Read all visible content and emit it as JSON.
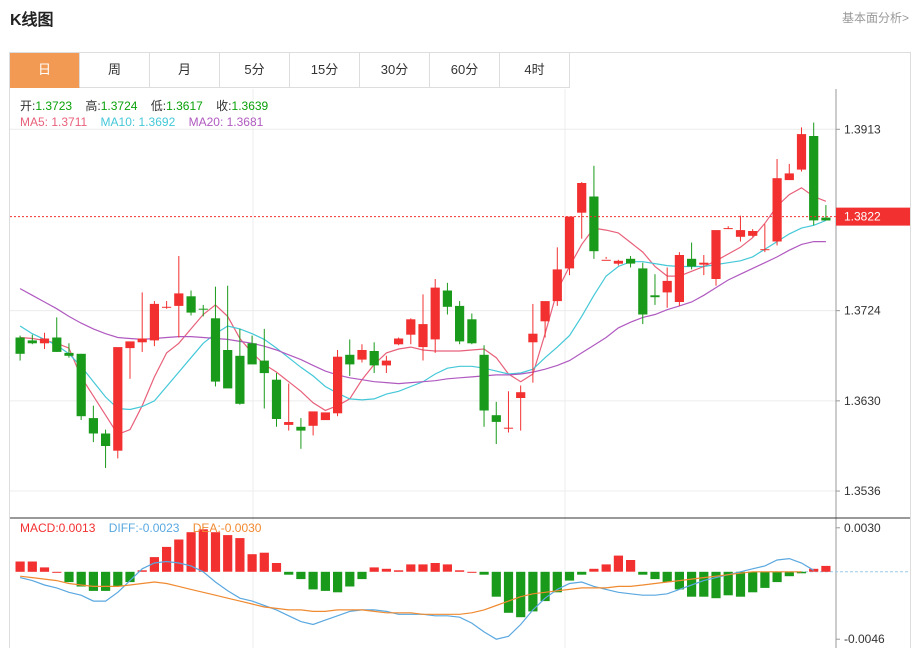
{
  "header": {
    "title": "K线图",
    "fundamental_link": "基本面分析>"
  },
  "tabs": [
    {
      "label": "日",
      "active": true
    },
    {
      "label": "周",
      "active": false
    },
    {
      "label": "月",
      "active": false
    },
    {
      "label": "5分",
      "active": false
    },
    {
      "label": "15分",
      "active": false
    },
    {
      "label": "30分",
      "active": false
    },
    {
      "label": "60分",
      "active": false
    },
    {
      "label": "4时",
      "active": false
    }
  ],
  "ohlc": {
    "open_label": "开:",
    "open": "1.3723",
    "high_label": "高:",
    "high": "1.3724",
    "low_label": "低:",
    "low": "1.3617",
    "close_label": "收:",
    "close": "1.3639"
  },
  "ma": {
    "ma5_label": "MA5:",
    "ma5": "1.3711",
    "ma10_label": "MA10:",
    "ma10": "1.3692",
    "ma20_label": "MA20:",
    "ma20": "1.3681"
  },
  "macd": {
    "macd_label": "MACD:",
    "macd": "0.0013",
    "diff_label": "DIFF:",
    "diff": "-0.0023",
    "dea_label": "DEA:",
    "dea": "-0.0030"
  },
  "colors": {
    "up": "#f23030",
    "down": "#1a9a1a",
    "ma5": "#e8607a",
    "ma10": "#44c8d8",
    "ma20": "#b05ac0",
    "diff": "#5aa8e0",
    "dea": "#f08a30",
    "tab_active": "#f29a53",
    "current_price": "#f23030"
  },
  "chart_data": {
    "type": "candlestick",
    "current_price": "1.3822",
    "y_ticks": [
      "1.3913",
      "1.3724",
      "1.3630",
      "1.3536"
    ],
    "ylim": [
      1.351,
      1.3955
    ],
    "grid": true,
    "candles": [
      [
        1.3696,
        1.3698,
        1.3672,
        1.3679
      ],
      [
        1.3693,
        1.3699,
        1.3689,
        1.369
      ],
      [
        1.369,
        1.3701,
        1.3684,
        1.3695
      ],
      [
        1.3696,
        1.3717,
        1.3681,
        1.3681
      ],
      [
        1.368,
        1.369,
        1.3675,
        1.3677
      ],
      [
        1.3679,
        1.3679,
        1.361,
        1.3614
      ],
      [
        1.3612,
        1.3625,
        1.3587,
        1.3596
      ],
      [
        1.3596,
        1.36,
        1.356,
        1.3583
      ],
      [
        1.3578,
        1.3683,
        1.357,
        1.3686
      ],
      [
        1.3685,
        1.369,
        1.3653,
        1.3692
      ],
      [
        1.3691,
        1.3743,
        1.3681,
        1.3695
      ],
      [
        1.3693,
        1.3734,
        1.3687,
        1.3731
      ],
      [
        1.3728,
        1.3734,
        1.3726,
        1.3728
      ],
      [
        1.3729,
        1.3781,
        1.3696,
        1.3742
      ],
      [
        1.3739,
        1.3745,
        1.3719,
        1.3722
      ],
      [
        1.3726,
        1.373,
        1.3718,
        1.3725
      ],
      [
        1.3716,
        1.3749,
        1.3645,
        1.365
      ],
      [
        1.3683,
        1.375,
        1.3646,
        1.3643
      ],
      [
        1.3677,
        1.3705,
        1.3626,
        1.3627
      ],
      [
        1.369,
        1.3698,
        1.3669,
        1.3668
      ],
      [
        1.3672,
        1.3705,
        1.3622,
        1.3659
      ],
      [
        1.3652,
        1.3659,
        1.3603,
        1.3611
      ],
      [
        1.3605,
        1.3648,
        1.3599,
        1.3608
      ],
      [
        1.3603,
        1.3612,
        1.358,
        1.3599
      ],
      [
        1.3604,
        1.3618,
        1.3594,
        1.3619
      ],
      [
        1.361,
        1.3616,
        1.3611,
        1.3618
      ],
      [
        1.3617,
        1.3683,
        1.3614,
        1.3676
      ],
      [
        1.3678,
        1.3694,
        1.3656,
        1.3668
      ],
      [
        1.3673,
        1.3689,
        1.367,
        1.3683
      ],
      [
        1.3682,
        1.3691,
        1.3659,
        1.3667
      ],
      [
        1.3667,
        1.3677,
        1.3659,
        1.3672
      ],
      [
        1.3689,
        1.3696,
        1.3688,
        1.3695
      ],
      [
        1.3699,
        1.3716,
        1.3689,
        1.3715
      ],
      [
        1.3686,
        1.3741,
        1.3672,
        1.371
      ],
      [
        1.3694,
        1.3757,
        1.368,
        1.3748
      ],
      [
        1.3745,
        1.3753,
        1.372,
        1.3728
      ],
      [
        1.3729,
        1.3734,
        1.3689,
        1.3692
      ],
      [
        1.3715,
        1.3721,
        1.3689,
        1.369
      ],
      [
        1.3678,
        1.3688,
        1.3603,
        1.362
      ],
      [
        1.3615,
        1.3629,
        1.3585,
        1.3608
      ],
      [
        1.3602,
        1.364,
        1.3597,
        1.3602
      ],
      [
        1.3633,
        1.3646,
        1.3599,
        1.3639
      ],
      [
        1.3691,
        1.3731,
        1.3649,
        1.37
      ],
      [
        1.3713,
        1.3715,
        1.3696,
        1.3734
      ],
      [
        1.3734,
        1.379,
        1.3729,
        1.3767
      ],
      [
        1.3768,
        1.3822,
        1.3761,
        1.3822
      ],
      [
        1.3826,
        1.3858,
        1.3799,
        1.3857
      ],
      [
        1.3843,
        1.3875,
        1.3778,
        1.3786
      ],
      [
        1.3776,
        1.3778,
        1.378,
        1.3777
      ],
      [
        1.3773,
        1.3777,
        1.3771,
        1.3776
      ],
      [
        1.3778,
        1.3781,
        1.3769,
        1.3773
      ],
      [
        1.3768,
        1.3774,
        1.371,
        1.372
      ],
      [
        1.374,
        1.3762,
        1.373,
        1.3738
      ],
      [
        1.3743,
        1.3769,
        1.3727,
        1.3755
      ],
      [
        1.3733,
        1.3785,
        1.3729,
        1.3782
      ],
      [
        1.3778,
        1.3795,
        1.3767,
        1.377
      ],
      [
        1.3772,
        1.3782,
        1.3761,
        1.3774
      ],
      [
        1.3757,
        1.3801,
        1.375,
        1.3808
      ],
      [
        1.381,
        1.3812,
        1.3809,
        1.381
      ],
      [
        1.3801,
        1.3823,
        1.3796,
        1.3808
      ],
      [
        1.3802,
        1.3809,
        1.3801,
        1.3807
      ],
      [
        1.3787,
        1.3814,
        1.3785,
        1.3788
      ],
      [
        1.3796,
        1.3882,
        1.3792,
        1.3862
      ],
      [
        1.386,
        1.3877,
        1.3863,
        1.3867
      ],
      [
        1.3871,
        1.3915,
        1.3869,
        1.3908
      ],
      [
        1.3906,
        1.392,
        1.3813,
        1.3818
      ],
      [
        1.3821,
        1.3834,
        1.3819,
        1.3818
      ]
    ],
    "ma5": [
      1.3696,
      1.3695,
      1.3693,
      1.369,
      1.3685,
      1.3655,
      1.3635,
      1.3615,
      1.3595,
      1.36,
      1.3625,
      1.3655,
      1.368,
      1.369,
      1.3705,
      1.372,
      1.373,
      1.3718,
      1.3695,
      1.368,
      1.3668,
      1.366,
      1.365,
      1.364,
      1.3628,
      1.362,
      1.3625,
      1.3632,
      1.3652,
      1.3668,
      1.368,
      1.3684,
      1.3686,
      1.3683,
      1.3682,
      1.3682,
      1.3682,
      1.3683,
      1.3684,
      1.3675,
      1.3658,
      1.365,
      1.3658,
      1.37,
      1.3745,
      1.377,
      1.3793,
      1.381,
      1.3808,
      1.3805,
      1.3795,
      1.3785,
      1.377,
      1.376,
      1.376,
      1.3765,
      1.377,
      1.3776,
      1.3783,
      1.379,
      1.38,
      1.3815,
      1.3833,
      1.3845,
      1.3852,
      1.3843,
      1.3838
    ],
    "ma10": [
      1.3708,
      1.37,
      1.3694,
      1.3688,
      1.3679,
      1.3666,
      1.365,
      1.3634,
      1.3622,
      1.3621,
      1.3624,
      1.363,
      1.3645,
      1.366,
      1.3675,
      1.369,
      1.37,
      1.3708,
      1.3705,
      1.37,
      1.3694,
      1.3685,
      1.3675,
      1.3665,
      1.3656,
      1.3645,
      1.3638,
      1.3632,
      1.3631,
      1.3632,
      1.3637,
      1.364,
      1.3645,
      1.365,
      1.3658,
      1.3664,
      1.3666,
      1.3666,
      1.3664,
      1.3661,
      1.3658,
      1.3659,
      1.3663,
      1.3675,
      1.3686,
      1.3698,
      1.3718,
      1.374,
      1.376,
      1.377,
      1.3775,
      1.3775,
      1.3773,
      1.3771,
      1.377,
      1.377,
      1.377,
      1.3772,
      1.3774,
      1.3776,
      1.378,
      1.3788,
      1.3796,
      1.3804,
      1.381,
      1.3813,
      1.3818
    ],
    "ma20": [
      1.3747,
      1.374,
      1.3733,
      1.3726,
      1.3718,
      1.3711,
      1.3705,
      1.37,
      1.3696,
      1.3695,
      1.3694,
      1.3695,
      1.3696,
      1.3697,
      1.3697,
      1.3696,
      1.3695,
      1.3694,
      1.3692,
      1.369,
      1.3687,
      1.3683,
      1.3678,
      1.3673,
      1.3667,
      1.3661,
      1.3657,
      1.3654,
      1.3652,
      1.365,
      1.3649,
      1.3648,
      1.3649,
      1.365,
      1.3651,
      1.3653,
      1.3654,
      1.3655,
      1.3656,
      1.3657,
      1.3657,
      1.3658,
      1.366,
      1.3663,
      1.3667,
      1.3672,
      1.368,
      1.3688,
      1.3696,
      1.3706,
      1.3712,
      1.3717,
      1.372,
      1.3725,
      1.3729,
      1.3733,
      1.374,
      1.3748,
      1.3756,
      1.3762,
      1.3768,
      1.3774,
      1.378,
      1.3787,
      1.3793,
      1.3796,
      1.3796
    ],
    "macd_ticks": [
      "0.0030",
      "-0.0046"
    ],
    "macd_ylim": [
      -0.0052,
      0.0036
    ],
    "macd_hist": [
      0.0007,
      0.0007,
      0.0003,
      0.0,
      -0.0007,
      -0.001,
      -0.0013,
      -0.0013,
      -0.001,
      -0.0007,
      0.0001,
      0.001,
      0.0017,
      0.0022,
      0.0027,
      0.0029,
      0.0027,
      0.0025,
      0.0023,
      0.0012,
      0.0013,
      0.0006,
      -0.0002,
      -0.0005,
      -0.0012,
      -0.0013,
      -0.0014,
      -0.001,
      -0.0005,
      0.0003,
      0.0002,
      0.0001,
      0.0005,
      0.0005,
      0.0006,
      0.0005,
      0.0001,
      0.0,
      -0.0002,
      -0.0017,
      -0.0028,
      -0.0031,
      -0.0027,
      -0.002,
      -0.0014,
      -0.0006,
      -0.0002,
      0.0002,
      0.0005,
      0.0011,
      0.0008,
      -0.0002,
      -0.0005,
      -0.0007,
      -0.0012,
      -0.0017,
      -0.0017,
      -0.0018,
      -0.0016,
      -0.0017,
      -0.0014,
      -0.0011,
      -0.0007,
      -0.0003,
      -0.0001,
      0.0002,
      0.0004,
      0.0008,
      0.0009,
      0.0011,
      -0.0001
    ],
    "diff": [
      -0.0004,
      -0.0006,
      -0.0009,
      -0.0011,
      -0.0014,
      -0.0016,
      -0.002,
      -0.002,
      -0.0014,
      -0.0006,
      0.0002,
      0.0006,
      0.0007,
      0.0006,
      0.0004,
      0.0,
      -0.0007,
      -0.0013,
      -0.0018,
      -0.002,
      -0.0023,
      -0.0026,
      -0.003,
      -0.0034,
      -0.0036,
      -0.0033,
      -0.003,
      -0.0027,
      -0.0026,
      -0.0026,
      -0.0027,
      -0.0029,
      -0.0029,
      -0.0029,
      -0.003,
      -0.003,
      -0.0031,
      -0.0035,
      -0.0041,
      -0.0046,
      -0.0044,
      -0.0036,
      -0.0026,
      -0.0018,
      -0.0012,
      -0.0008,
      -0.0007,
      -0.001,
      -0.0012,
      -0.0014,
      -0.0015,
      -0.0016,
      -0.0016,
      -0.0015,
      -0.0012,
      -0.0009,
      -0.0006,
      -0.0004,
      -0.0002,
      0.0,
      0.0002,
      0.0004,
      0.0008,
      0.0009,
      0.0006,
      0.0001
    ],
    "dea": [
      -0.0003,
      -0.0004,
      -0.0005,
      -0.0006,
      -0.0008,
      -0.0009,
      -0.001,
      -0.001,
      -0.001,
      -0.0009,
      -0.0008,
      -0.0007,
      -0.0008,
      -0.001,
      -0.0012,
      -0.0014,
      -0.0016,
      -0.0018,
      -0.002,
      -0.0022,
      -0.0024,
      -0.0025,
      -0.0026,
      -0.0026,
      -0.0027,
      -0.0027,
      -0.0026,
      -0.0026,
      -0.0026,
      -0.0027,
      -0.0028,
      -0.0028,
      -0.0028,
      -0.0029,
      -0.0029,
      -0.0029,
      -0.0029,
      -0.0028,
      -0.0026,
      -0.0023,
      -0.002,
      -0.0017,
      -0.0015,
      -0.0014,
      -0.0013,
      -0.0012,
      -0.0011,
      -0.0011,
      -0.0011,
      -0.001,
      -0.001,
      -0.0009,
      -0.0008,
      -0.0007,
      -0.0006,
      -0.0005,
      -0.0004,
      -0.0003,
      -0.0002,
      -0.0001,
      0.0,
      0.0,
      0.0,
      0.0,
      0.0
    ]
  }
}
